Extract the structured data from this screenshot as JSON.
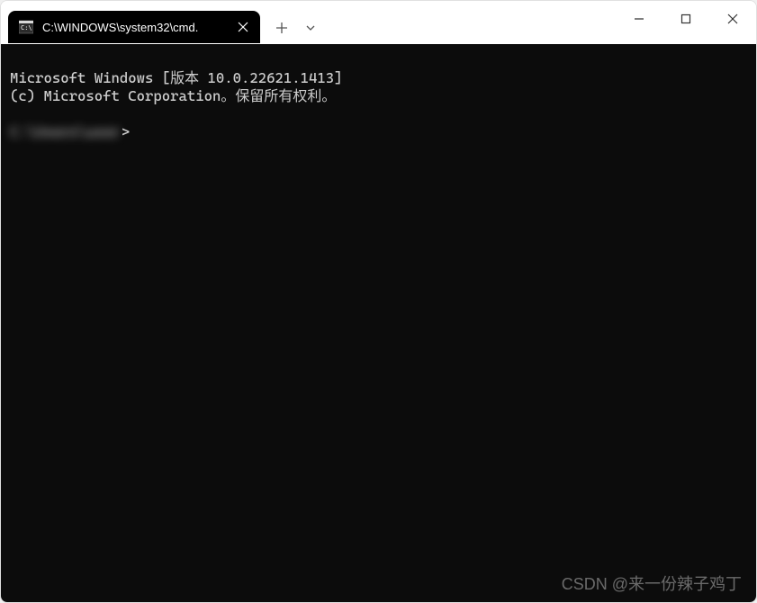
{
  "tab": {
    "title": "C:\\WINDOWS\\system32\\cmd."
  },
  "terminal": {
    "line1": "Microsoft Windows [版本 10.0.22621.1413]",
    "line2": "(c) Microsoft Corporation。保留所有权利。",
    "prompt_blurred": "C:\\Users\\user",
    "prompt_suffix": ">"
  },
  "watermark": "CSDN @来一份辣子鸡丁"
}
